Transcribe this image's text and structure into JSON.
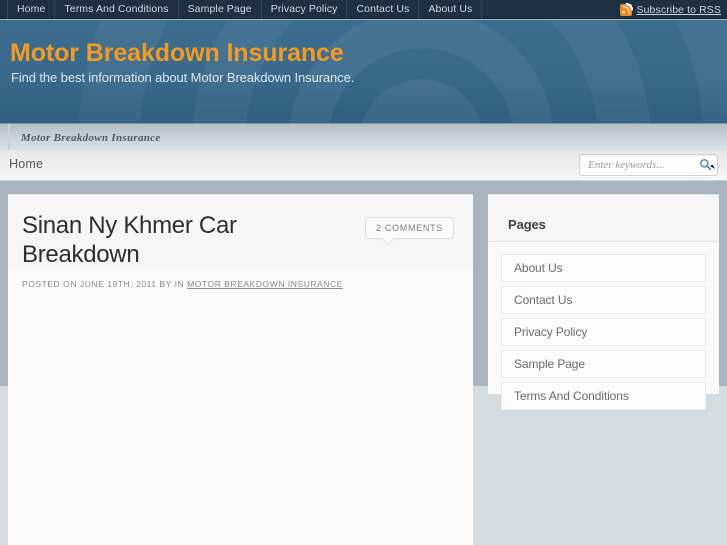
{
  "topnav": {
    "items": [
      {
        "label": "Home"
      },
      {
        "label": "Terms And Conditions"
      },
      {
        "label": "Sample Page"
      },
      {
        "label": "Privacy Policy"
      },
      {
        "label": "Contact Us"
      },
      {
        "label": "About Us"
      }
    ],
    "rss_label": "Subscribe to RSS",
    "rss_icon": "rss-icon"
  },
  "masthead": {
    "title": "Motor Breakdown Insurance",
    "description": "Find the best information about Motor Breakdown Insurance.",
    "title_color": "#f49a22",
    "background_color": "#3a6a8b"
  },
  "breadcrumb": {
    "text": "Motor Breakdown Insurance"
  },
  "toolbar": {
    "home_label": "Home",
    "search_placeholder": "Enter keywords...",
    "search_value": "",
    "search_icon": "magnifier-icon"
  },
  "post": {
    "title": "Sinan Ny Khmer Car Breakdown",
    "comments_label": "2 COMMENTS",
    "meta_prefix": "POSTED ON JUNE 19TH, 2011 BY IN",
    "meta_category": "MOTOR BREAKDOWN INSURANCE"
  },
  "sidebar": {
    "widget_title": "Pages",
    "pages": [
      {
        "label": "About Us"
      },
      {
        "label": "Contact Us"
      },
      {
        "label": "Privacy Policy"
      },
      {
        "label": "Sample Page"
      },
      {
        "label": "Terms And Conditions"
      }
    ]
  }
}
